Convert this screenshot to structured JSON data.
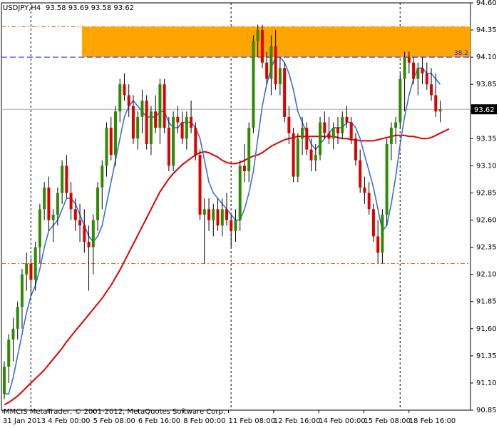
{
  "header": {
    "symbol": "USDJPY,H4",
    "ohlc": "93.58 93.69 93.58 93.62"
  },
  "copyright": "MMCIS MetaTrader, © 2001-2012, MetaQuotes Software Corp.",
  "current_price_label": "93.62",
  "fib_label": "38.2",
  "colors": {
    "bull": "#2e8b00",
    "bear": "#e00000",
    "ma_fast": "#3a6fd8",
    "ma_slow": "#e00000",
    "zone": "#ffa500",
    "fib_line": "#1a1aff",
    "level_line": "#d2691e"
  },
  "chart_data": {
    "type": "candlestick",
    "y_ticks": [
      "94.60",
      "94.35",
      "94.10",
      "93.85",
      "93.60",
      "93.35",
      "93.10",
      "92.85",
      "92.60",
      "92.35",
      "92.10",
      "91.85",
      "91.60",
      "91.35",
      "91.10",
      "90.85"
    ],
    "x_ticks": [
      "31 Jan 2013",
      "4 Feb 00:00",
      "5 Feb 08:00",
      "6 Feb 16:00",
      "8 Feb 00:00",
      "11 Feb 08:00",
      "12 Feb 16:00",
      "14 Feb 00:00",
      "15 Feb 08:00",
      "18 Feb 16:00"
    ],
    "ylim": [
      90.85,
      94.6
    ],
    "resistance_zone": [
      94.1,
      94.38
    ],
    "levels": [
      94.38,
      92.2
    ],
    "fib_level": 94.1,
    "current_price": 93.62,
    "candles": [
      [
        91.0,
        91.3,
        90.95,
        91.25
      ],
      [
        91.25,
        91.55,
        91.1,
        91.5
      ],
      [
        91.5,
        91.7,
        91.3,
        91.6
      ],
      [
        91.6,
        91.85,
        91.5,
        91.8
      ],
      [
        91.8,
        92.15,
        91.6,
        92.1
      ],
      [
        92.1,
        92.3,
        91.95,
        92.2
      ],
      [
        92.2,
        92.25,
        91.9,
        92.05
      ],
      [
        92.05,
        92.4,
        91.95,
        92.35
      ],
      [
        92.35,
        92.75,
        92.2,
        92.7
      ],
      [
        92.7,
        92.95,
        92.6,
        92.9
      ],
      [
        92.9,
        93.0,
        92.5,
        92.6
      ],
      [
        92.6,
        92.7,
        92.4,
        92.65
      ],
      [
        92.65,
        92.9,
        92.55,
        92.85
      ],
      [
        92.85,
        93.15,
        92.75,
        93.1
      ],
      [
        93.1,
        93.2,
        92.8,
        92.85
      ],
      [
        92.85,
        92.95,
        92.6,
        92.7
      ],
      [
        92.7,
        92.8,
        92.5,
        92.6
      ],
      [
        92.6,
        92.75,
        92.4,
        92.55
      ],
      [
        92.55,
        92.7,
        92.3,
        92.4
      ],
      [
        92.4,
        92.55,
        91.95,
        92.35
      ],
      [
        92.35,
        92.65,
        92.1,
        92.6
      ],
      [
        92.6,
        92.95,
        92.5,
        92.9
      ],
      [
        92.9,
        93.15,
        92.7,
        93.1
      ],
      [
        93.1,
        93.5,
        93.0,
        93.45
      ],
      [
        93.45,
        93.55,
        93.15,
        93.2
      ],
      [
        93.2,
        93.65,
        93.1,
        93.6
      ],
      [
        93.6,
        93.9,
        93.5,
        93.85
      ],
      [
        93.85,
        93.95,
        93.7,
        93.75
      ],
      [
        93.75,
        93.85,
        93.55,
        93.65
      ],
      [
        93.65,
        93.75,
        93.3,
        93.35
      ],
      [
        93.35,
        93.6,
        93.25,
        93.55
      ],
      [
        93.55,
        93.8,
        93.4,
        93.7
      ],
      [
        93.7,
        93.75,
        93.25,
        93.3
      ],
      [
        93.3,
        93.65,
        93.2,
        93.6
      ],
      [
        93.6,
        93.75,
        93.4,
        93.45
      ],
      [
        93.45,
        93.9,
        93.3,
        93.85
      ],
      [
        93.85,
        93.9,
        93.4,
        93.45
      ],
      [
        93.45,
        93.55,
        93.05,
        93.1
      ],
      [
        93.1,
        93.6,
        93.05,
        93.55
      ],
      [
        93.55,
        93.65,
        93.4,
        93.5
      ],
      [
        93.5,
        93.6,
        93.3,
        93.35
      ],
      [
        93.35,
        93.6,
        93.25,
        93.55
      ],
      [
        93.55,
        93.7,
        93.4,
        93.45
      ],
      [
        93.45,
        93.5,
        93.15,
        93.2
      ],
      [
        93.2,
        93.25,
        92.6,
        92.65
      ],
      [
        92.65,
        92.8,
        92.2,
        92.7
      ],
      [
        92.7,
        92.8,
        92.5,
        92.6
      ],
      [
        92.6,
        92.75,
        92.45,
        92.7
      ],
      [
        92.7,
        92.8,
        92.5,
        92.55
      ],
      [
        92.55,
        92.8,
        92.45,
        92.7
      ],
      [
        92.7,
        92.85,
        92.55,
        92.6
      ],
      [
        92.6,
        92.65,
        92.35,
        92.5
      ],
      [
        92.5,
        92.7,
        92.4,
        92.6
      ],
      [
        92.6,
        93.15,
        92.5,
        93.1
      ],
      [
        93.1,
        93.3,
        92.95,
        93.05
      ],
      [
        93.05,
        93.5,
        92.95,
        93.45
      ],
      [
        93.45,
        94.3,
        93.4,
        94.25
      ],
      [
        94.25,
        94.4,
        94.1,
        94.35
      ],
      [
        94.35,
        94.4,
        94.0,
        94.05
      ],
      [
        94.05,
        94.15,
        93.85,
        93.9
      ],
      [
        93.9,
        94.3,
        93.75,
        94.2
      ],
      [
        94.2,
        94.35,
        93.8,
        93.85
      ],
      [
        93.85,
        94.1,
        93.75,
        94.0
      ],
      [
        94.0,
        94.05,
        93.5,
        93.55
      ],
      [
        93.55,
        93.65,
        93.3,
        93.4
      ],
      [
        93.4,
        93.45,
        92.95,
        93.0
      ],
      [
        93.0,
        93.4,
        92.95,
        93.35
      ],
      [
        93.35,
        93.55,
        93.2,
        93.45
      ],
      [
        93.45,
        93.5,
        93.2,
        93.25
      ],
      [
        93.25,
        93.35,
        93.05,
        93.15
      ],
      [
        93.15,
        93.3,
        93.05,
        93.2
      ],
      [
        93.2,
        93.55,
        93.15,
        93.5
      ],
      [
        93.5,
        93.6,
        93.35,
        93.4
      ],
      [
        93.4,
        93.55,
        93.3,
        93.35
      ],
      [
        93.35,
        93.5,
        93.25,
        93.45
      ],
      [
        93.45,
        93.55,
        93.3,
        93.4
      ],
      [
        93.4,
        93.6,
        93.35,
        93.55
      ],
      [
        93.55,
        93.65,
        93.45,
        93.5
      ],
      [
        93.5,
        93.55,
        93.3,
        93.35
      ],
      [
        93.35,
        93.4,
        93.1,
        93.15
      ],
      [
        93.15,
        93.25,
        92.85,
        92.9
      ],
      [
        92.9,
        93.0,
        92.75,
        92.85
      ],
      [
        92.85,
        92.95,
        92.65,
        92.7
      ],
      [
        92.7,
        92.75,
        92.4,
        92.45
      ],
      [
        92.45,
        92.6,
        92.2,
        92.3
      ],
      [
        92.3,
        92.7,
        92.2,
        92.65
      ],
      [
        92.65,
        93.35,
        92.55,
        93.3
      ],
      [
        93.3,
        93.5,
        93.15,
        93.45
      ],
      [
        93.45,
        93.55,
        93.3,
        93.5
      ],
      [
        93.5,
        93.95,
        93.45,
        93.9
      ],
      [
        93.9,
        94.15,
        93.6,
        94.1
      ],
      [
        94.1,
        94.15,
        93.95,
        94.05
      ],
      [
        94.05,
        94.1,
        93.85,
        93.9
      ],
      [
        93.9,
        94.05,
        93.75,
        94.0
      ],
      [
        94.0,
        94.1,
        93.85,
        93.95
      ],
      [
        93.95,
        94.05,
        93.8,
        93.85
      ],
      [
        93.85,
        94.0,
        93.7,
        93.75
      ],
      [
        93.75,
        93.95,
        93.55,
        93.6
      ],
      [
        93.6,
        93.7,
        93.5,
        93.62
      ]
    ],
    "ma_fast": [
      91.0,
      91.0,
      91.15,
      91.35,
      91.55,
      91.75,
      91.9,
      92.0,
      92.15,
      92.35,
      92.5,
      92.55,
      92.6,
      92.7,
      92.8,
      92.8,
      92.75,
      92.65,
      92.55,
      92.45,
      92.4,
      92.45,
      92.55,
      92.75,
      92.95,
      93.15,
      93.35,
      93.55,
      93.65,
      93.7,
      93.65,
      93.6,
      93.55,
      93.55,
      93.55,
      93.6,
      93.6,
      93.5,
      93.45,
      93.45,
      93.5,
      93.5,
      93.5,
      93.45,
      93.35,
      93.15,
      92.95,
      92.85,
      92.8,
      92.75,
      92.7,
      92.65,
      92.6,
      92.6,
      92.7,
      92.85,
      93.05,
      93.35,
      93.65,
      93.85,
      94.0,
      94.1,
      94.1,
      94.05,
      93.95,
      93.8,
      93.6,
      93.5,
      93.4,
      93.3,
      93.25,
      93.3,
      93.35,
      93.4,
      93.45,
      93.45,
      93.45,
      93.5,
      93.5,
      93.45,
      93.35,
      93.2,
      93.05,
      92.9,
      92.7,
      92.5,
      92.55,
      92.75,
      93.0,
      93.3,
      93.55,
      93.75,
      93.9,
      94.0,
      94.0,
      93.95,
      93.95,
      93.9,
      93.85
    ],
    "ma_slow": [
      90.9,
      90.92,
      90.95,
      90.98,
      91.02,
      91.06,
      91.1,
      91.14,
      91.18,
      91.22,
      91.27,
      91.32,
      91.37,
      91.42,
      91.48,
      91.53,
      91.58,
      91.63,
      91.68,
      91.73,
      91.78,
      91.83,
      91.88,
      91.94,
      92.0,
      92.07,
      92.14,
      92.22,
      92.3,
      92.38,
      92.46,
      92.54,
      92.62,
      92.7,
      92.78,
      92.86,
      92.92,
      92.98,
      93.03,
      93.07,
      93.11,
      93.14,
      93.17,
      93.2,
      93.22,
      93.23,
      93.22,
      93.2,
      93.18,
      93.15,
      93.13,
      93.12,
      93.12,
      93.13,
      93.15,
      93.17,
      93.19,
      93.2,
      93.22,
      93.25,
      93.28,
      93.3,
      93.32,
      93.34,
      93.35,
      93.36,
      93.37,
      93.37,
      93.37,
      93.37,
      93.37,
      93.37,
      93.37,
      93.37,
      93.37,
      93.36,
      93.35,
      93.35,
      93.34,
      93.34,
      93.33,
      93.33,
      93.33,
      93.33,
      93.34,
      93.35,
      93.36,
      93.37,
      93.38,
      93.38,
      93.38,
      93.37,
      93.37,
      93.36,
      93.35,
      93.35,
      93.36,
      93.38,
      93.4,
      93.42,
      93.44
    ]
  }
}
